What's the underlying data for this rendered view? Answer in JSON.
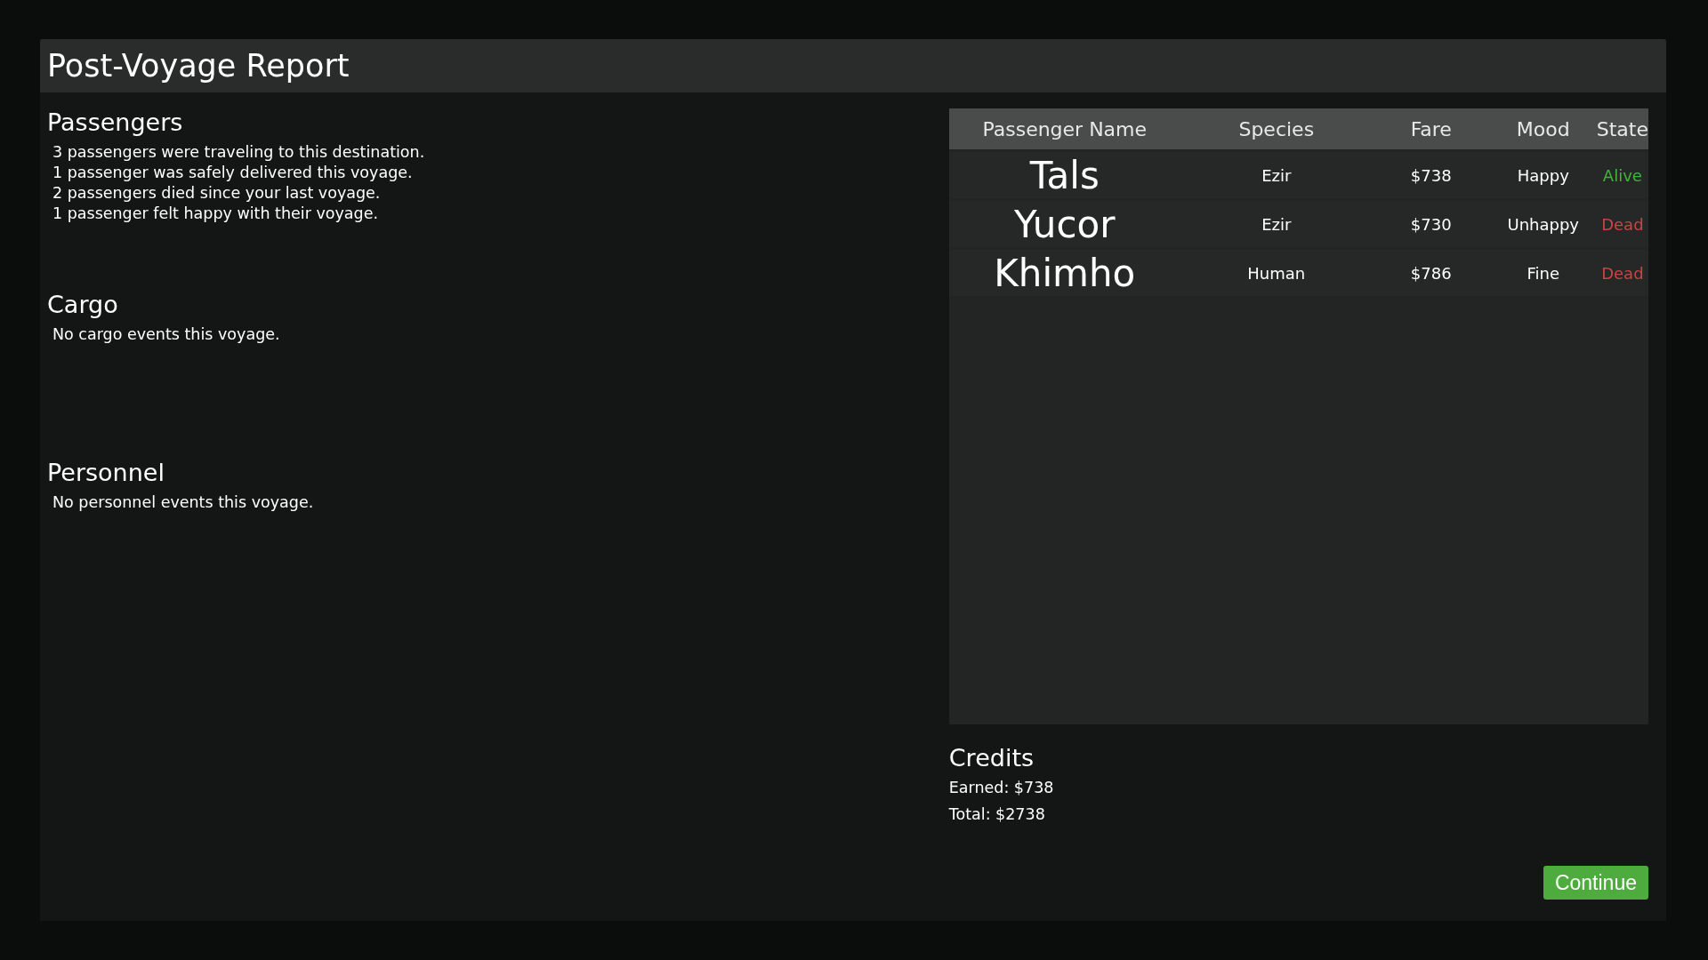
{
  "window": {
    "title": "Post-Voyage Report"
  },
  "sections": [
    {
      "heading": "Passengers",
      "lines": [
        "3 passengers were traveling to this destination.",
        "1 passenger was safely delivered this voyage.",
        "2 passengers died since your last voyage.",
        "1 passenger felt happy with their voyage."
      ]
    },
    {
      "heading": "Cargo",
      "lines": [
        "No cargo events this voyage."
      ]
    },
    {
      "heading": "Personnel",
      "lines": [
        "No personnel events this voyage."
      ]
    }
  ],
  "table": {
    "columns": [
      "Passenger Name",
      "Species",
      "Fare",
      "Mood",
      "State"
    ],
    "rows": [
      {
        "name": "Tals",
        "species": "Ezir",
        "fare": "$738",
        "mood": "Happy",
        "state": "Alive",
        "color": "#3fb63a"
      },
      {
        "name": "Yucor",
        "species": "Ezir",
        "fare": "$730",
        "mood": "Unhappy",
        "state": "Dead",
        "color": "#c94444"
      },
      {
        "name": "Khimho",
        "species": "Human",
        "fare": "$786",
        "mood": "Fine",
        "state": "Dead",
        "color": "#c94444"
      }
    ]
  },
  "credits": {
    "heading": "Credits",
    "earned": "Earned: $738",
    "total": "Total: $2738"
  },
  "buttons": [
    "Continue"
  ]
}
